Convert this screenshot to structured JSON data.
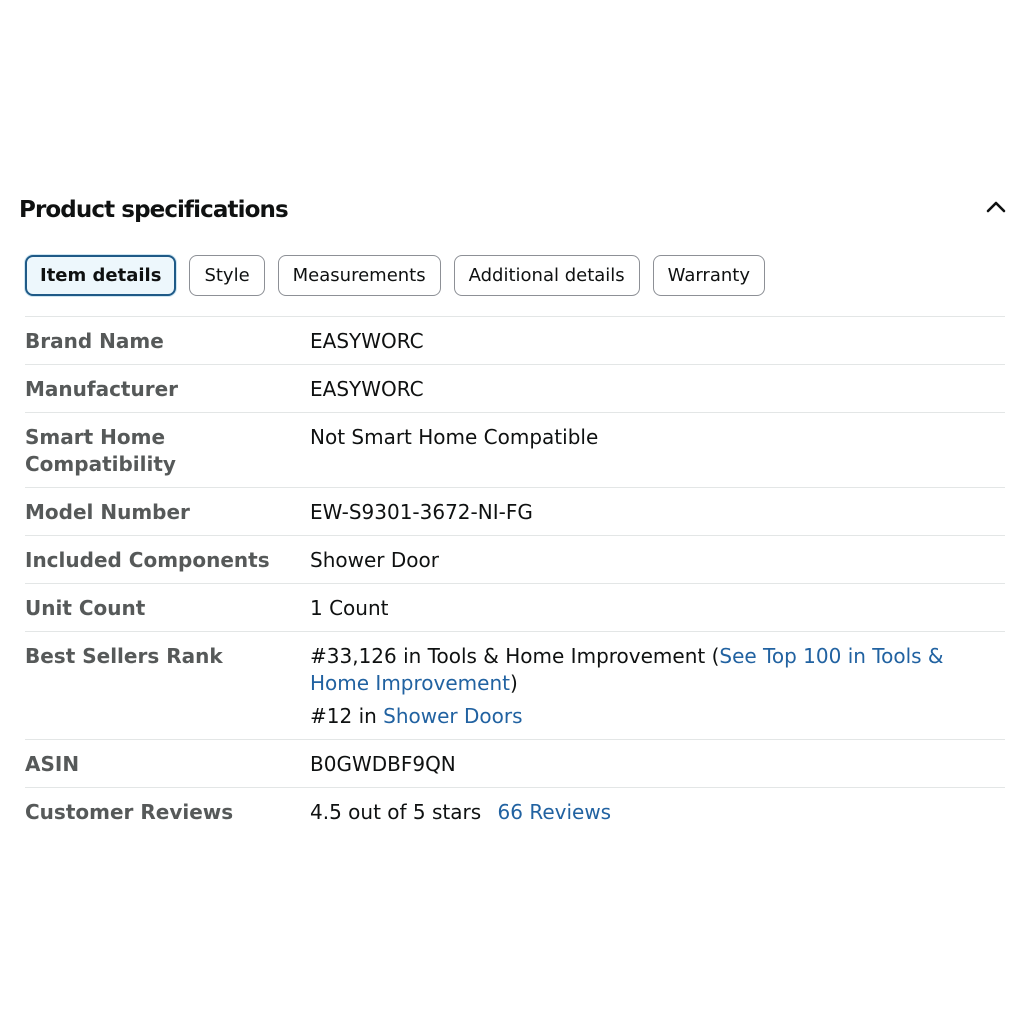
{
  "section": {
    "title": "Product specifications"
  },
  "tabs": [
    {
      "label": "Item details",
      "active": true
    },
    {
      "label": "Style",
      "active": false
    },
    {
      "label": "Measurements",
      "active": false
    },
    {
      "label": "Additional details",
      "active": false
    },
    {
      "label": "Warranty",
      "active": false
    }
  ],
  "specs": {
    "brand_name": {
      "label": "Brand Name",
      "value": "EASYWORC"
    },
    "manufacturer": {
      "label": "Manufacturer",
      "value": "EASYWORC"
    },
    "smart_home": {
      "label": "Smart Home Compatibility",
      "value": "Not Smart Home Compatible"
    },
    "model_number": {
      "label": "Model Number",
      "value": "EW-S9301-3672-NI-FG"
    },
    "included_components": {
      "label": "Included Components",
      "value": "Shower Door"
    },
    "unit_count": {
      "label": "Unit Count",
      "value": "1 Count"
    },
    "best_sellers_rank": {
      "label": "Best Sellers Rank",
      "rank1_text": "#33,126 in Tools & Home Improvement (",
      "rank1_link": "See Top 100 in Tools & Home Improvement",
      "rank1_close": ")",
      "rank2_text": "#12 in ",
      "rank2_link": "Shower Doors"
    },
    "asin": {
      "label": "ASIN",
      "value": "B0GWDBF9QN"
    },
    "customer_reviews": {
      "label": "Customer Reviews",
      "rating_text": "4.5 out of 5 stars",
      "reviews_count": "66",
      "reviews_link": "Reviews"
    }
  },
  "colors": {
    "link": "#2162a1",
    "label": "#565959",
    "active_tab_border": "#1f5a87",
    "active_tab_bg": "#edf7fc"
  },
  "icons": {
    "collapse": "chevron-up-icon"
  }
}
